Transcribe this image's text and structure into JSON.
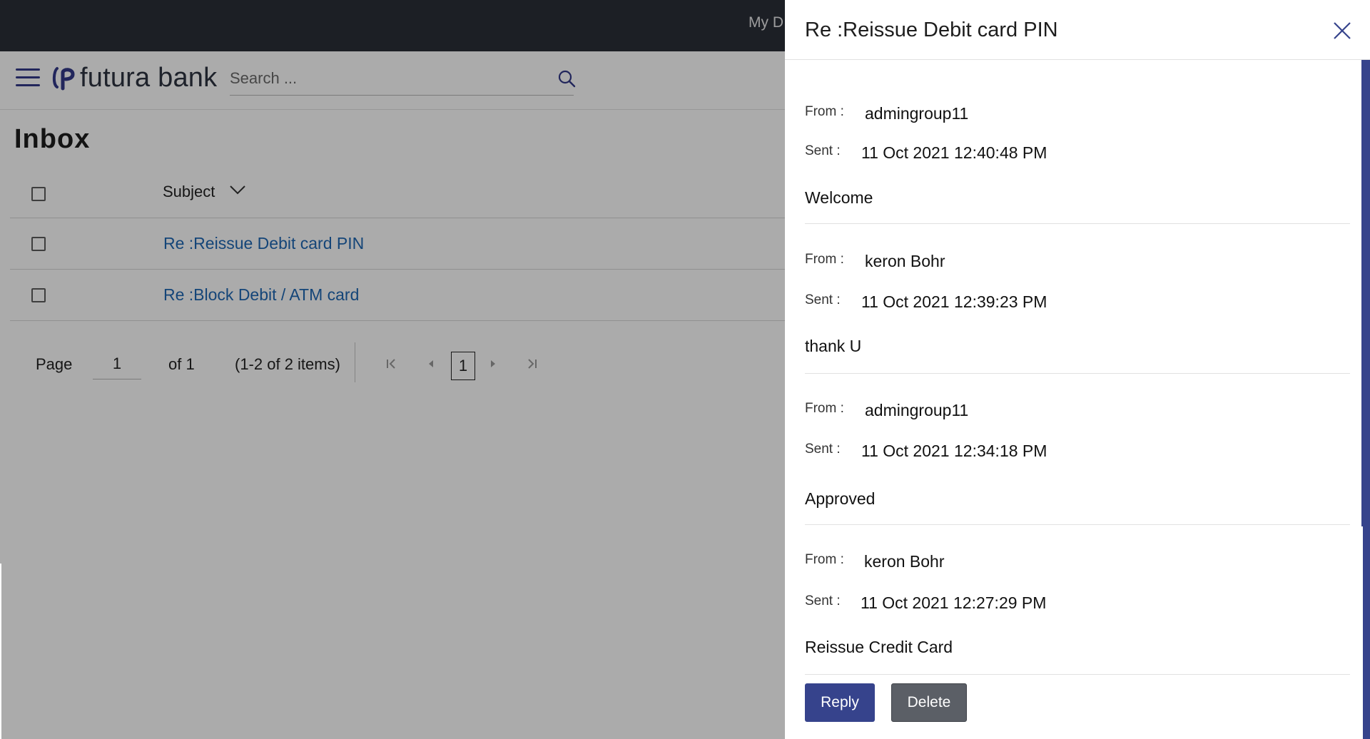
{
  "topbar": {
    "text": "My D"
  },
  "brand": {
    "name": "futura bank"
  },
  "search": {
    "placeholder": "Search ...",
    "value": ""
  },
  "page": {
    "title": "Inbox"
  },
  "table": {
    "column_subject": "Subject",
    "rows": [
      {
        "subject": "Re :Reissue Debit card PIN"
      },
      {
        "subject": "Re :Block Debit / ATM card"
      }
    ]
  },
  "pager": {
    "page_label": "Page",
    "page_value": "1",
    "of_label": "of 1",
    "items_label": "(1-2 of 2 items)",
    "current": "1"
  },
  "panel": {
    "title": "Re :Reissue Debit card PIN",
    "from_label": "From :",
    "sent_label": "Sent :",
    "messages": [
      {
        "from": "admingroup11",
        "sent": "11 Oct 2021 12:40:48 PM",
        "body": "Welcome"
      },
      {
        "from": "keron Bohr",
        "sent": "11 Oct 2021 12:39:23 PM",
        "body": "thank U"
      },
      {
        "from": "admingroup11",
        "sent": "11 Oct 2021 12:34:18 PM",
        "body": "Approved"
      },
      {
        "from": "keron Bohr",
        "sent": "11 Oct 2021 12:27:29 PM",
        "body": "Reissue Credit Card"
      }
    ],
    "reply_label": "Reply",
    "delete_label": "Delete"
  },
  "colors": {
    "topbar": "#2b2f38",
    "brand_accent": "#36438c",
    "link": "#1f67b4",
    "delete_button": "#5b5f66"
  }
}
